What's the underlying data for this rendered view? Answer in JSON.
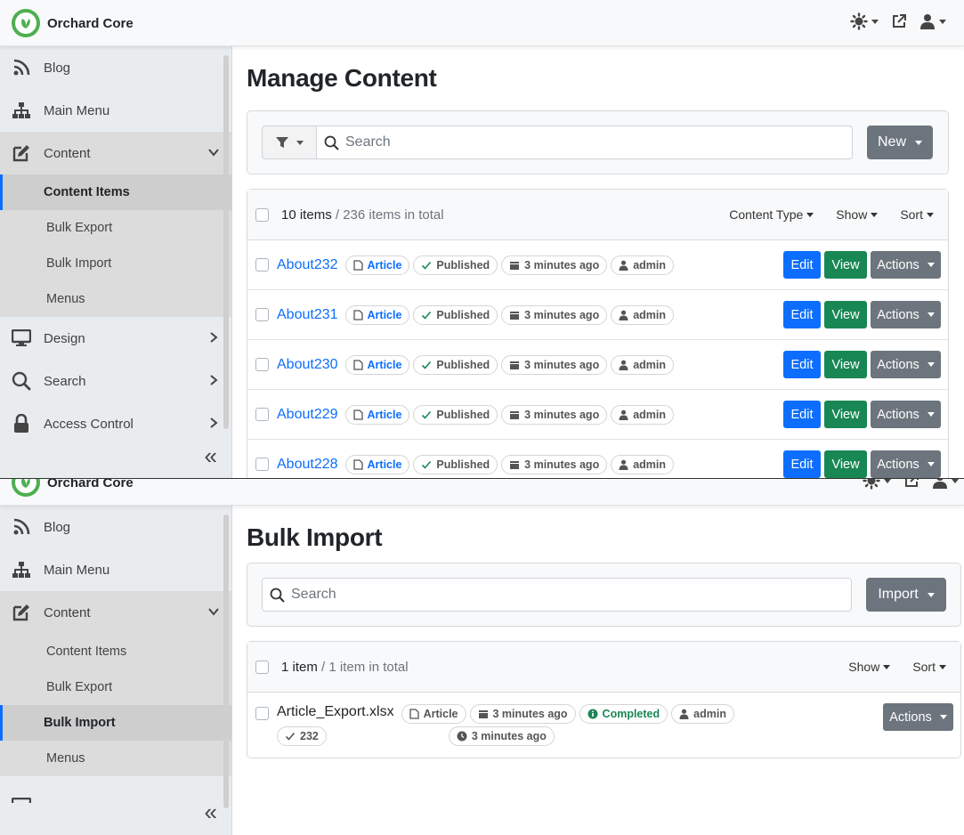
{
  "brand": {
    "name": "Orchard Core"
  },
  "colors": {
    "primary": "#0d6efd",
    "success": "#198754",
    "secondary": "#6c757d",
    "brand_green": "#4caf50"
  },
  "sidebar": {
    "items": [
      {
        "label": "Blog",
        "icon": "rss-icon"
      },
      {
        "label": "Main Menu",
        "icon": "sitemap-icon"
      },
      {
        "label": "Content",
        "icon": "edit-icon"
      },
      {
        "label": "Design",
        "icon": "monitor-icon"
      },
      {
        "label": "Search",
        "icon": "search-icon"
      },
      {
        "label": "Access Control",
        "icon": "lock-icon"
      }
    ],
    "content_sub": [
      "Content Items",
      "Bulk Export",
      "Bulk Import",
      "Menus"
    ],
    "collapse": "«"
  },
  "manage": {
    "title": "Manage Content",
    "search_placeholder": "Search",
    "new_label": "New",
    "count": "10 items",
    "total": "/ 236 items in total",
    "menus": [
      "Content Type",
      "Show",
      "Sort"
    ],
    "rows": [
      {
        "title": "About232",
        "type": "Article",
        "status": "Published",
        "time": "3 minutes ago",
        "user": "admin"
      },
      {
        "title": "About231",
        "type": "Article",
        "status": "Published",
        "time": "3 minutes ago",
        "user": "admin"
      },
      {
        "title": "About230",
        "type": "Article",
        "status": "Published",
        "time": "3 minutes ago",
        "user": "admin"
      },
      {
        "title": "About229",
        "type": "Article",
        "status": "Published",
        "time": "3 minutes ago",
        "user": "admin"
      },
      {
        "title": "About228",
        "type": "Article",
        "status": "Published",
        "time": "3 minutes ago",
        "user": "admin"
      }
    ],
    "edit_label": "Edit",
    "view_label": "View",
    "actions_label": "Actions"
  },
  "bulk": {
    "title": "Bulk Import",
    "search_placeholder": "Search",
    "import_label": "Import",
    "count": "1 item",
    "total": "/ 1 item in total",
    "menus": [
      "Show",
      "Sort"
    ],
    "row": {
      "title": "Article_Export.xlsx",
      "type": "Article",
      "time": "3 minutes ago",
      "status": "Completed",
      "user": "admin",
      "count": "232",
      "completed_time": "3 minutes ago"
    },
    "actions_label": "Actions"
  }
}
